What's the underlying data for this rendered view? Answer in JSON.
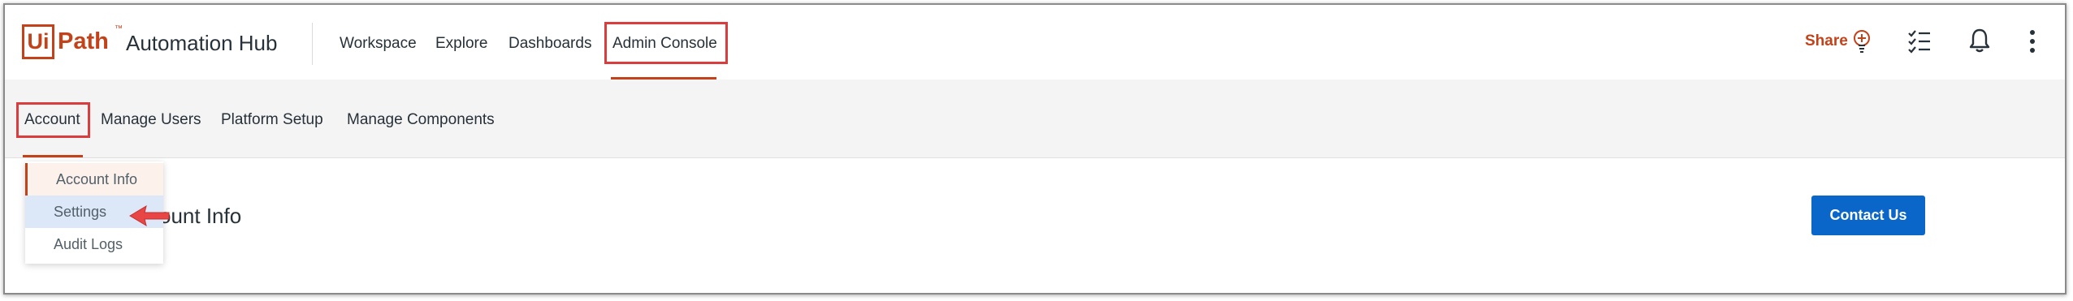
{
  "brand": {
    "logo_ui": "Ui",
    "logo_path": "Path",
    "logo_tm": "™",
    "app_name": "Automation Hub",
    "accent_color": "#c4421a"
  },
  "top_nav": {
    "items": [
      {
        "label": "Workspace"
      },
      {
        "label": "Explore"
      },
      {
        "label": "Dashboards"
      },
      {
        "label": "Admin Console",
        "active": true
      }
    ]
  },
  "top_right": {
    "share_label": "Share",
    "icons": [
      "lightbulb-plus-icon",
      "checklist-icon",
      "bell-icon",
      "more-vertical-icon"
    ]
  },
  "sub_nav": {
    "items": [
      {
        "label": "Account",
        "active": true
      },
      {
        "label": "Manage Users"
      },
      {
        "label": "Platform Setup"
      },
      {
        "label": "Manage Components"
      }
    ]
  },
  "account_menu": {
    "items": [
      {
        "label": "Account Info",
        "selected": true
      },
      {
        "label": "Settings",
        "hovered": true
      },
      {
        "label": "Audit Logs"
      }
    ]
  },
  "content": {
    "title": "ccount Info",
    "contact_button": "Contact Us"
  },
  "colors": {
    "highlight_box": "#d93d3d",
    "primary_button": "#0a66c8",
    "hover_row": "#dce8f7"
  }
}
